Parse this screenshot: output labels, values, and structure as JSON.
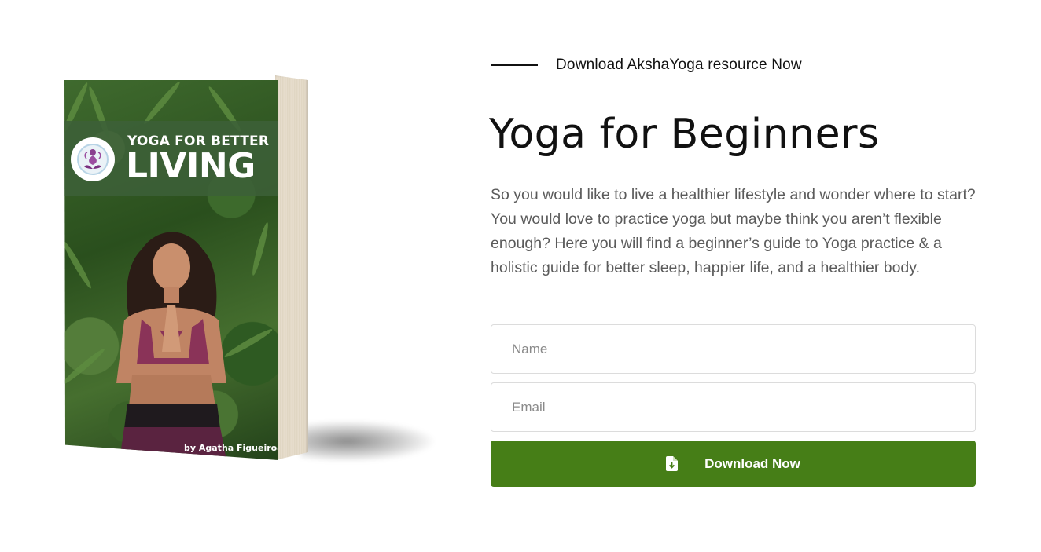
{
  "book": {
    "cover_title_line1": "YOGA FOR BETTER",
    "cover_title_line2": "LIVING",
    "author": "by Agatha Figueiroa"
  },
  "eyebrow": "Download AkshaYoga resource Now",
  "title": "Yoga for Beginners",
  "description": "So you would like to live a healthier lifestyle and wonder where to start? You would love to practice yoga but maybe think you aren’t flexible enough? Here you will find a beginner’s guide to Yoga practice & a holistic guide for better sleep, happier life, and a healthier body.",
  "form": {
    "name_placeholder": "Name",
    "name_value": "",
    "email_placeholder": "Email",
    "email_value": "",
    "button_label": "Download Now",
    "button_icon": "file-download-icon"
  },
  "colors": {
    "accent_green": "#467e17",
    "text_dark": "#111111",
    "text_muted": "#5b5b5b"
  }
}
